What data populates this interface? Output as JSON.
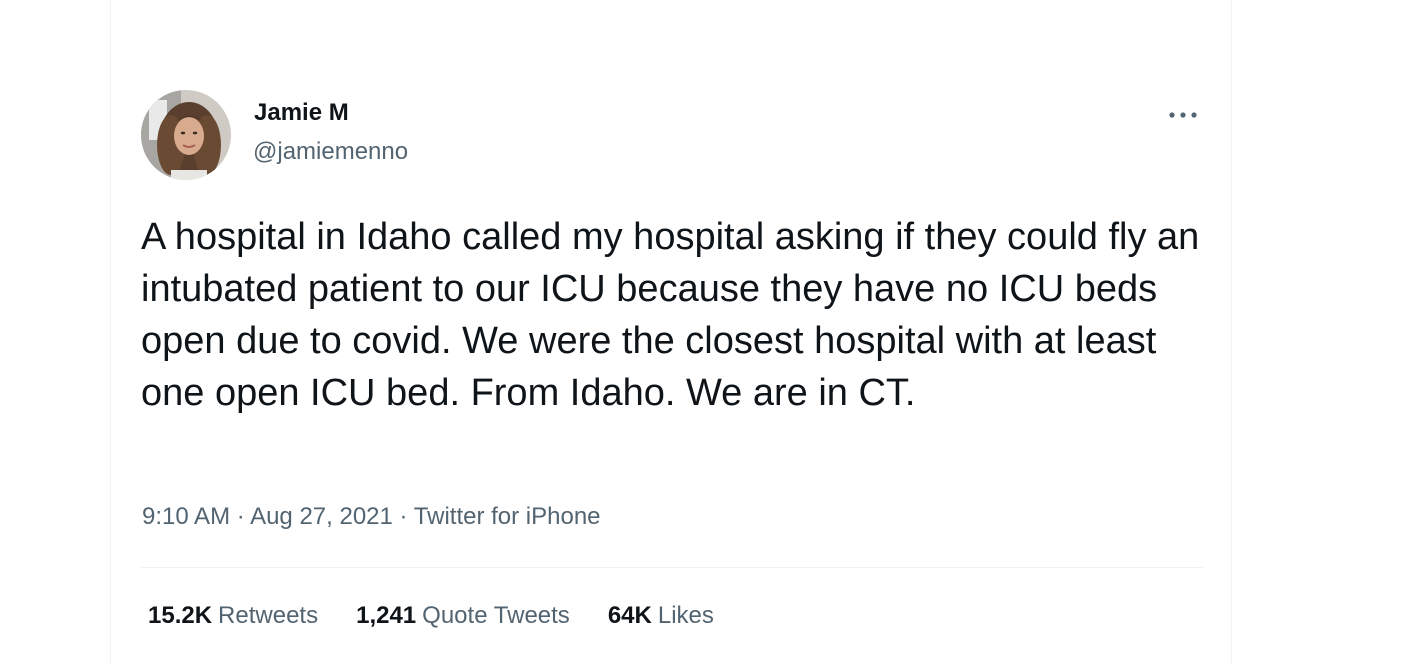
{
  "author": {
    "display_name": "Jamie M",
    "handle": "@jamiemenno"
  },
  "tweet": {
    "text": "A hospital in Idaho called my hospital asking if they could fly an intubated patient to our ICU because they have no ICU beds open due to covid. We were the closest hospital with at least one open ICU bed. From Idaho. We are in CT.",
    "time": "9:10 AM",
    "separator": "·",
    "date": "Aug 27, 2021",
    "source": "Twitter for iPhone"
  },
  "stats": {
    "retweets_count": "15.2K",
    "retweets_label": "Retweets",
    "quotes_count": "1,241",
    "quotes_label": "Quote Tweets",
    "likes_count": "64K",
    "likes_label": "Likes"
  },
  "icons": {
    "more": "more-horizontal-icon"
  },
  "colors": {
    "text_primary": "#0f1419",
    "text_secondary": "#536471",
    "divider": "#eff3f4"
  }
}
